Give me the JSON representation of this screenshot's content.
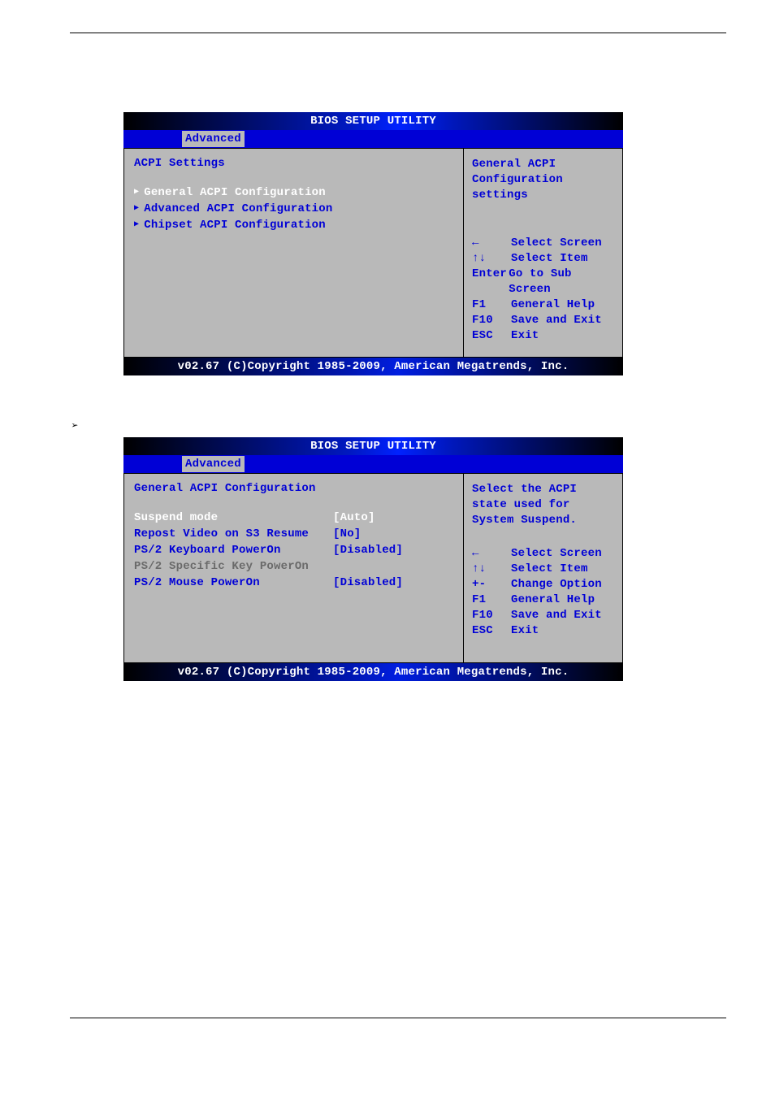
{
  "title": "BIOS SETUP UTILITY",
  "tab_label": "Advanced",
  "footer": "v02.67 (C)Copyright 1985-2009, American Megatrends, Inc.",
  "screen1": {
    "heading": "ACPI Settings",
    "items": [
      "General ACPI Configuration",
      "Advanced ACPI Configuration",
      "Chipset ACPI Configuration"
    ],
    "help": "General ACPI Configuration settings",
    "keys": [
      {
        "k": "←",
        "d": "Select Screen"
      },
      {
        "k": "↑↓",
        "d": "Select Item"
      },
      {
        "k": "Enter",
        "d": "Go to Sub Screen"
      },
      {
        "k": "F1",
        "d": "General Help"
      },
      {
        "k": "F10",
        "d": "Save and Exit"
      },
      {
        "k": "ESC",
        "d": "Exit"
      }
    ]
  },
  "screen2": {
    "heading": "General ACPI Configuration",
    "options": [
      {
        "label": "Suspend mode",
        "value": "[Auto]",
        "state": "selected"
      },
      {
        "label": "Repost Video on S3 Resume",
        "value": "[No]",
        "state": "normal"
      },
      {
        "label": "PS/2 Keyboard PowerOn",
        "value": "[Disabled]",
        "state": "normal"
      },
      {
        "label": "PS/2 Specific Key PowerOn",
        "value": "",
        "state": "disabled"
      },
      {
        "label": "PS/2 Mouse PowerOn",
        "value": "[Disabled]",
        "state": "normal"
      }
    ],
    "help": "Select the ACPI state used for System Suspend.",
    "keys": [
      {
        "k": "←",
        "d": "Select Screen"
      },
      {
        "k": "↑↓",
        "d": "Select Item"
      },
      {
        "k": "+-",
        "d": "Change Option"
      },
      {
        "k": "F1",
        "d": "General Help"
      },
      {
        "k": "F10",
        "d": "Save and Exit"
      },
      {
        "k": "ESC",
        "d": "Exit"
      }
    ]
  }
}
